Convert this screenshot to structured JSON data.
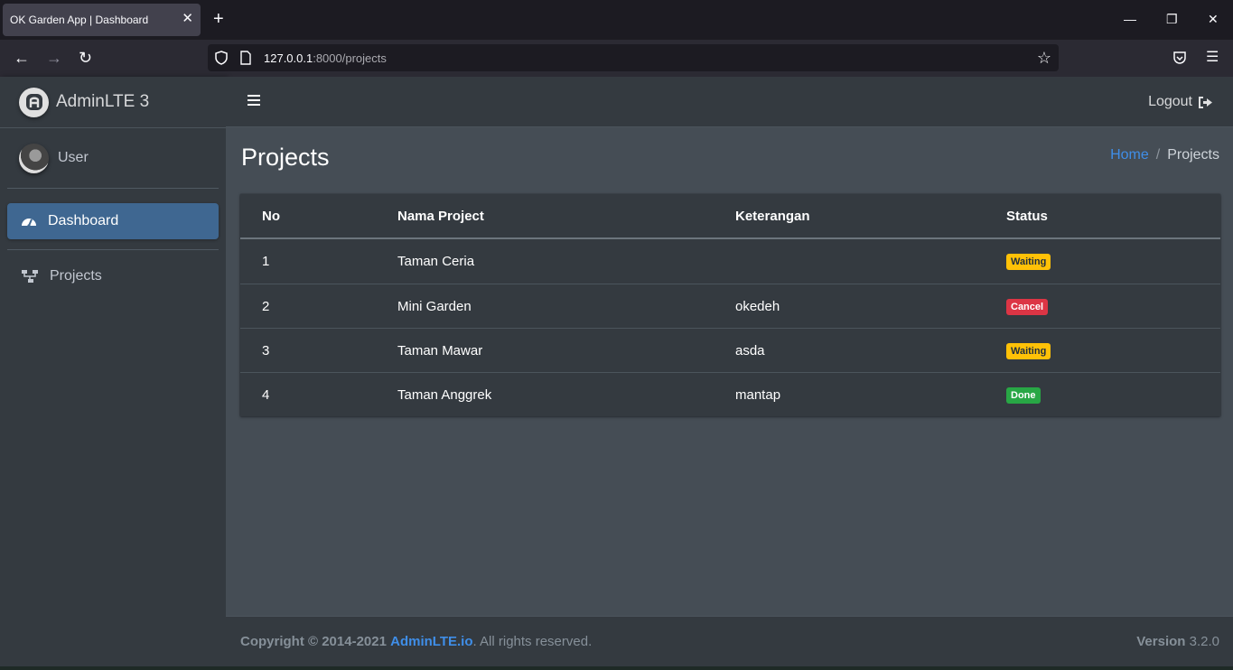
{
  "browser": {
    "tab_title": "OK Garden App | Dashboard",
    "url_host": "127.0.0.1",
    "url_path": ":8000/projects"
  },
  "sidebar": {
    "brand": "AdminLTE 3",
    "user": "User",
    "items": [
      {
        "label": "Dashboard",
        "icon": "tachometer-icon",
        "active": true
      },
      {
        "label": "Projects",
        "icon": "sitemap-icon",
        "active": false
      }
    ]
  },
  "header": {
    "logout_label": "Logout"
  },
  "page": {
    "title": "Projects",
    "breadcrumb": {
      "home": "Home",
      "sep": "/",
      "current": "Projects"
    }
  },
  "table": {
    "columns": [
      "No",
      "Nama Project",
      "Keterangan",
      "Status"
    ],
    "rows": [
      {
        "no": "1",
        "name": "Taman Ceria",
        "desc": "",
        "status": "Waiting",
        "status_color": "#ffc107"
      },
      {
        "no": "2",
        "name": "Mini Garden",
        "desc": "okedeh",
        "status": "Cancel",
        "status_color": "#dc3545"
      },
      {
        "no": "3",
        "name": "Taman Mawar",
        "desc": "asda",
        "status": "Waiting",
        "status_color": "#ffc107"
      },
      {
        "no": "4",
        "name": "Taman Anggrek",
        "desc": "mantap",
        "status": "Done",
        "status_color": "#28a745"
      }
    ]
  },
  "footer": {
    "copyright_prefix": "Copyright © 2014-2021",
    "link": "AdminLTE.io",
    "suffix": ". All rights reserved.",
    "version_label": "Version",
    "version": "3.2.0"
  }
}
